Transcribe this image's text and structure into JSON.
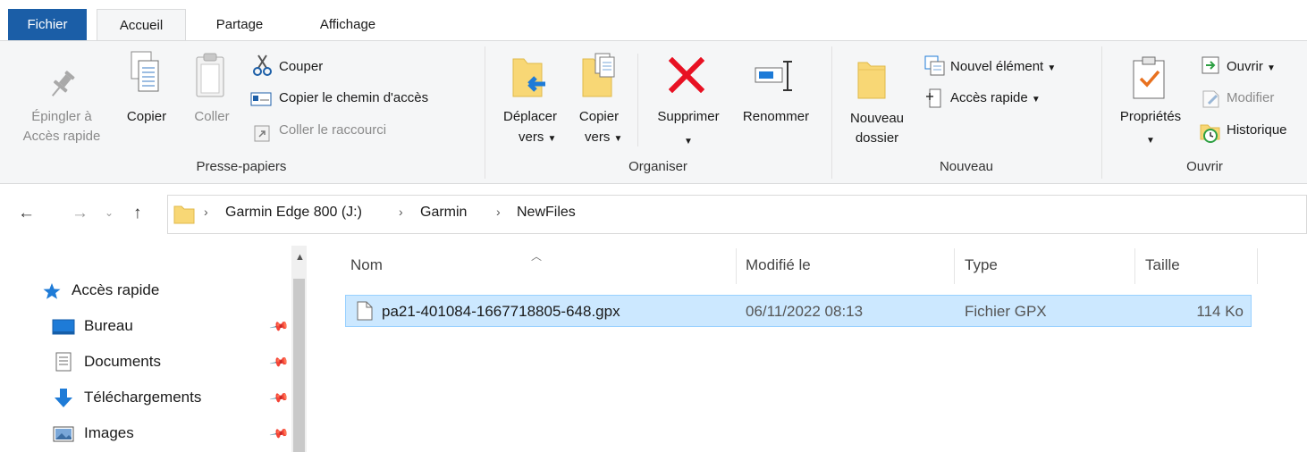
{
  "tabs": [
    {
      "label": "Fichier"
    },
    {
      "label": "Accueil"
    },
    {
      "label": "Partage"
    },
    {
      "label": "Affichage"
    }
  ],
  "ribbon": {
    "clipboard": {
      "pin_line1": "Épingler à",
      "pin_line2": "Accès rapide",
      "copy": "Copier",
      "paste": "Coller",
      "cut": "Couper",
      "copy_path": "Copier le chemin d'accès",
      "paste_shortcut": "Coller le raccourci",
      "label": "Presse-papiers"
    },
    "organize": {
      "move_line1": "Déplacer",
      "move_line2": "vers",
      "copyto_line1": "Copier",
      "copyto_line2": "vers",
      "delete": "Supprimer",
      "rename": "Renommer",
      "label": "Organiser"
    },
    "new": {
      "folder_line1": "Nouveau",
      "folder_line2": "dossier",
      "new_item": "Nouvel élément",
      "quick_access": "Accès rapide",
      "label": "Nouveau"
    },
    "open": {
      "properties": "Propriétés",
      "open": "Ouvrir",
      "edit": "Modifier",
      "history": "Historique",
      "label": "Ouvrir"
    }
  },
  "address": {
    "crumbs": [
      "Garmin Edge 800 (J:)",
      "Garmin",
      "NewFiles"
    ]
  },
  "nav": {
    "quick_access": "Accès rapide",
    "items": [
      {
        "label": "Bureau"
      },
      {
        "label": "Documents"
      },
      {
        "label": "Téléchargements"
      },
      {
        "label": "Images"
      }
    ]
  },
  "columns": {
    "name": "Nom",
    "modified": "Modifié le",
    "type": "Type",
    "size": "Taille"
  },
  "files": [
    {
      "name": "pa21-401084-1667718805-648.gpx",
      "modified": "06/11/2022 08:13",
      "type": "Fichier GPX",
      "size": "114 Ko"
    }
  ],
  "colors": {
    "file_tab": "#1b5ea7",
    "selection_bg": "#cce8ff",
    "selection_border": "#99d1ff",
    "delete_red": "#e81123",
    "folder_yellow": "#f8d775"
  }
}
